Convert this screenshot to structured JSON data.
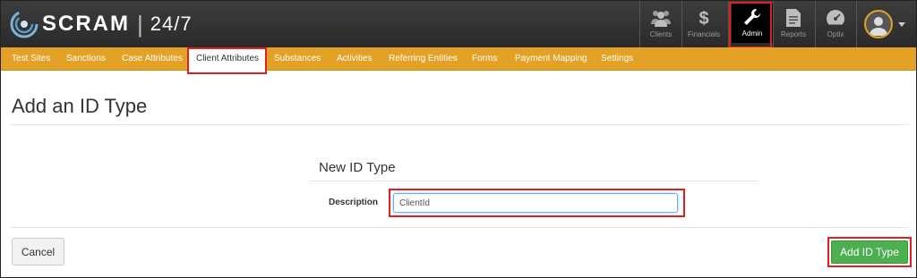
{
  "brand": {
    "name": "SCRAM",
    "separator": "|",
    "suffix": "24/7"
  },
  "nav": [
    {
      "label": "Clients",
      "icon": "users-icon"
    },
    {
      "label": "Financials",
      "icon": "dollar-icon"
    },
    {
      "label": "Admin",
      "icon": "wrench-icon",
      "active": true
    },
    {
      "label": "Reports",
      "icon": "document-icon"
    },
    {
      "label": "Optix",
      "icon": "dashboard-gauge-icon"
    }
  ],
  "menu": [
    {
      "label": "Test Sites"
    },
    {
      "label": "Sanctions"
    },
    {
      "label": "Case Attributes"
    },
    {
      "label": "Client Attributes",
      "active": true
    },
    {
      "label": "Substances"
    },
    {
      "label": "Activities"
    },
    {
      "label": "Referring Entities"
    },
    {
      "label": "Forms"
    },
    {
      "label": "Payment Mapping"
    },
    {
      "label": "Settings"
    }
  ],
  "page": {
    "title": "Add an ID Type"
  },
  "form": {
    "section_title": "New ID Type",
    "description_label": "Description",
    "description_value": "ClientId"
  },
  "buttons": {
    "cancel": "Cancel",
    "submit": "Add ID Type"
  },
  "colors": {
    "accent": "#e3a225",
    "header": "#333333",
    "success": "#4caf50",
    "highlight": "#e02020"
  }
}
